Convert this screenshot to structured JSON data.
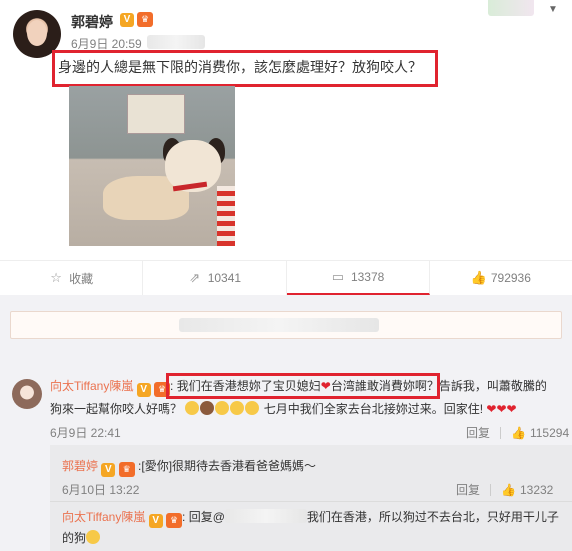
{
  "post": {
    "username": "郭碧婷",
    "vip_badge": "V",
    "date_time": "6月9日 20:59",
    "text": "身邊的人總是無下限的消费你，該怎麼處理好？放狗咬人？"
  },
  "actions": {
    "favorite": "收藏",
    "repost": "10341",
    "comment": "13378",
    "like": "792936"
  },
  "comments": [
    {
      "name": "向太Tiffany陳嵐",
      "colon": ":",
      "text_part1": "我们在香港想妳了宝贝媳妇",
      "text_part2": "台湾誰敢消費妳啊？告訴我，叫蕭敬騰的",
      "line2": "狗來一起幫你咬人好嗎？",
      "line2b": "七月中我们全家去台北接妳过来。回家住!",
      "time": "6月9日 22:41",
      "reply_label": "回复",
      "likes": "115294"
    }
  ],
  "replies": [
    {
      "name": "郭碧婷",
      "text": ":[愛你]很期待去香港看爸爸媽媽～",
      "time": "6月10日 13:22",
      "reply_label": "回复",
      "likes": "13232"
    },
    {
      "name": "向太Tiffany陳嵐",
      "text_prefix": ": 回复@",
      "text_suffix": "我们在香港，所以狗过不去台北，只好用干儿子",
      "line2": "的狗"
    }
  ],
  "colors": {
    "highlight": "#e0232f",
    "name_link": "#eb7350"
  }
}
